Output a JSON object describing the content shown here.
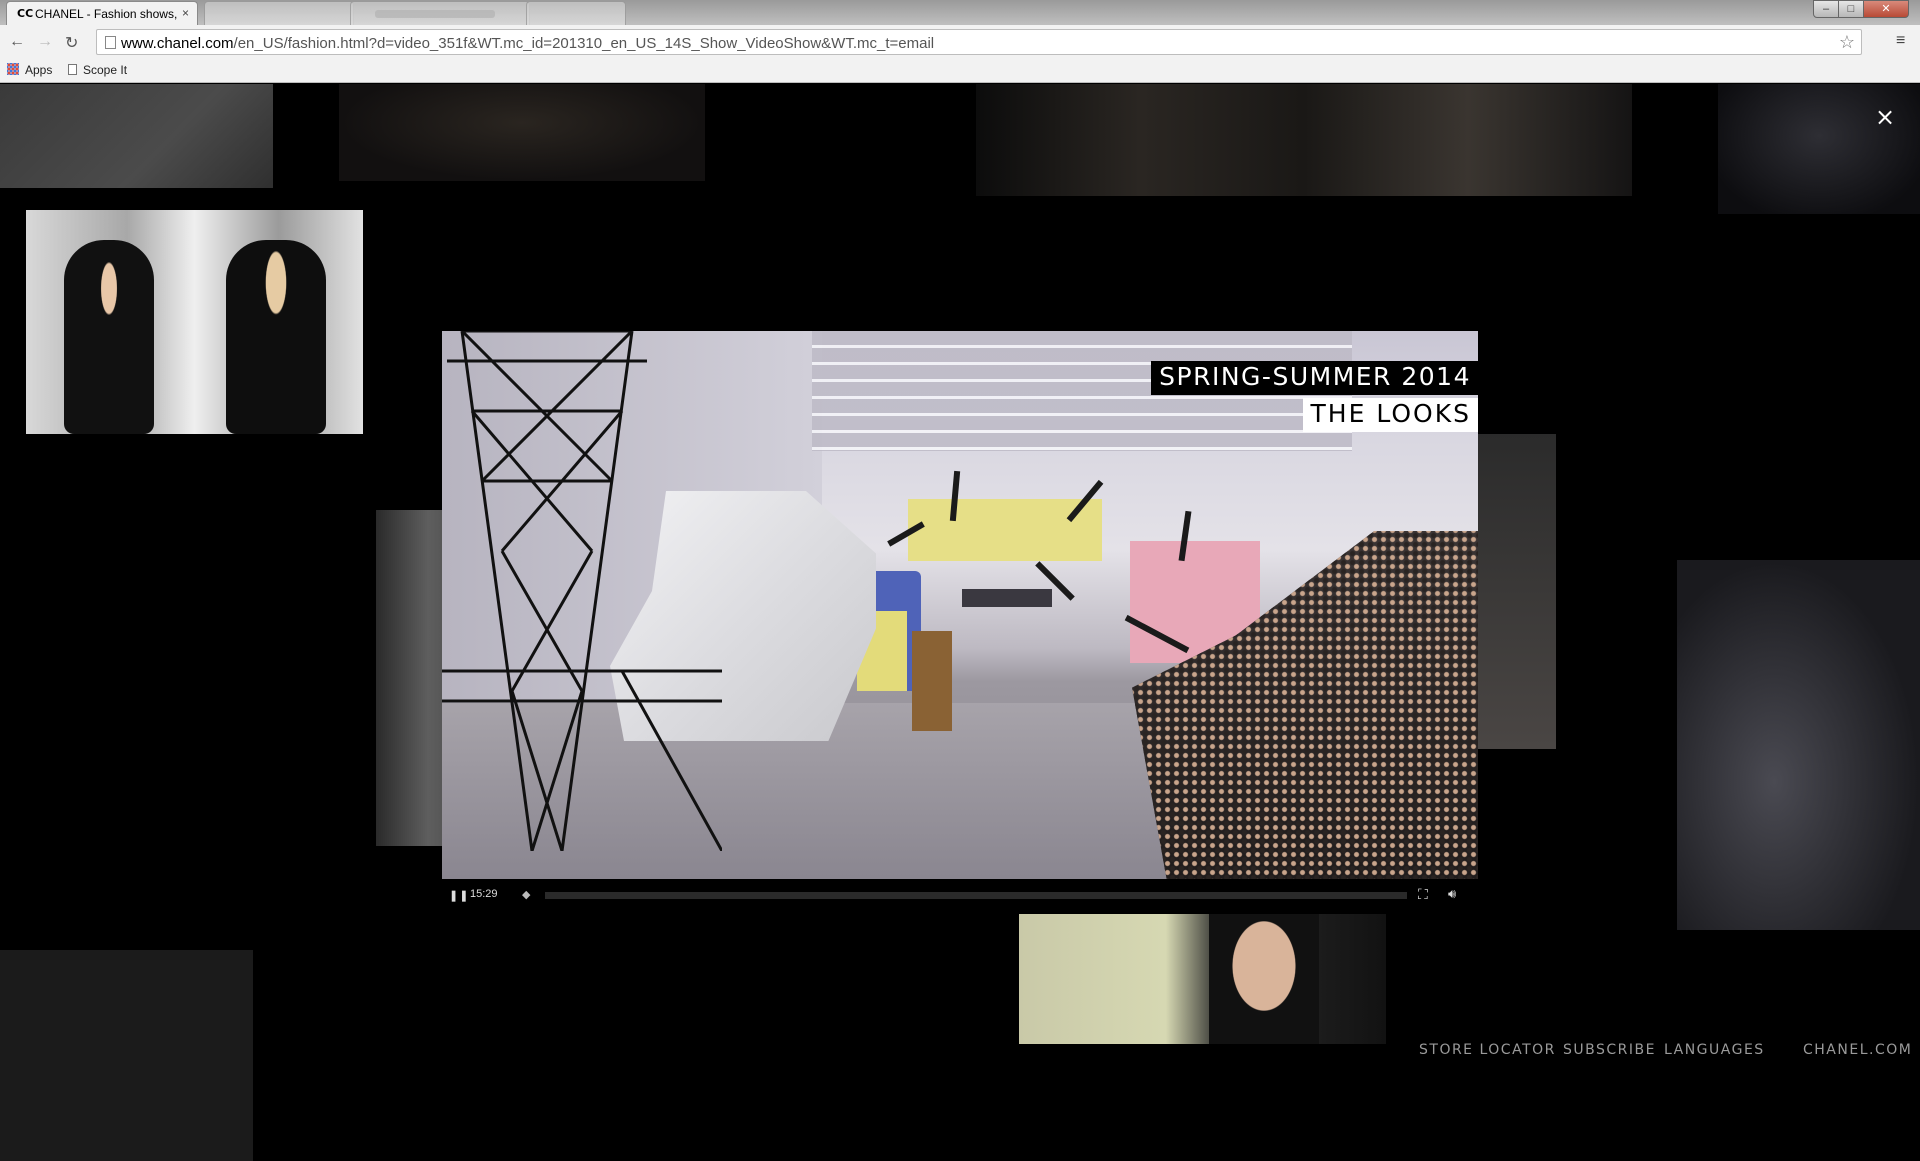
{
  "browser": {
    "active_tab_title": "CHANEL - Fashion shows,",
    "active_tab_logo": "CC",
    "tab_close": "×",
    "url_host": "www.chanel.com",
    "url_path": "/en_US/fashion.html?d=video_351f&WT.mc_id=201310_en_US_14S_Show_VideoShow&WT.mc_t=email",
    "bookmarks": [
      {
        "label": "Apps",
        "icon": "apps-grid-icon"
      },
      {
        "label": "Scope It",
        "icon": "page-icon"
      }
    ]
  },
  "video": {
    "title_line1": "SPRING-SUMMER 2014",
    "title_line2": "THE LOOKS",
    "time": "15:29",
    "progress_fraction": 0.0,
    "icons": {
      "pause": "pause-icon",
      "marker": "chapter-marker-icon",
      "fullscreen": "fullscreen-icon",
      "volume": "volume-icon"
    }
  },
  "overlay": {
    "close": "×"
  },
  "footer": {
    "links": [
      "STORE LOCATOR",
      "SUBSCRIBE",
      "LANGUAGES"
    ],
    "site": "CHANEL.COM"
  },
  "colors": {
    "background": "#000000",
    "footer_text": "#9a9a9a",
    "title_dark_bg": "#000000",
    "title_light_bg": "#ffffff"
  }
}
